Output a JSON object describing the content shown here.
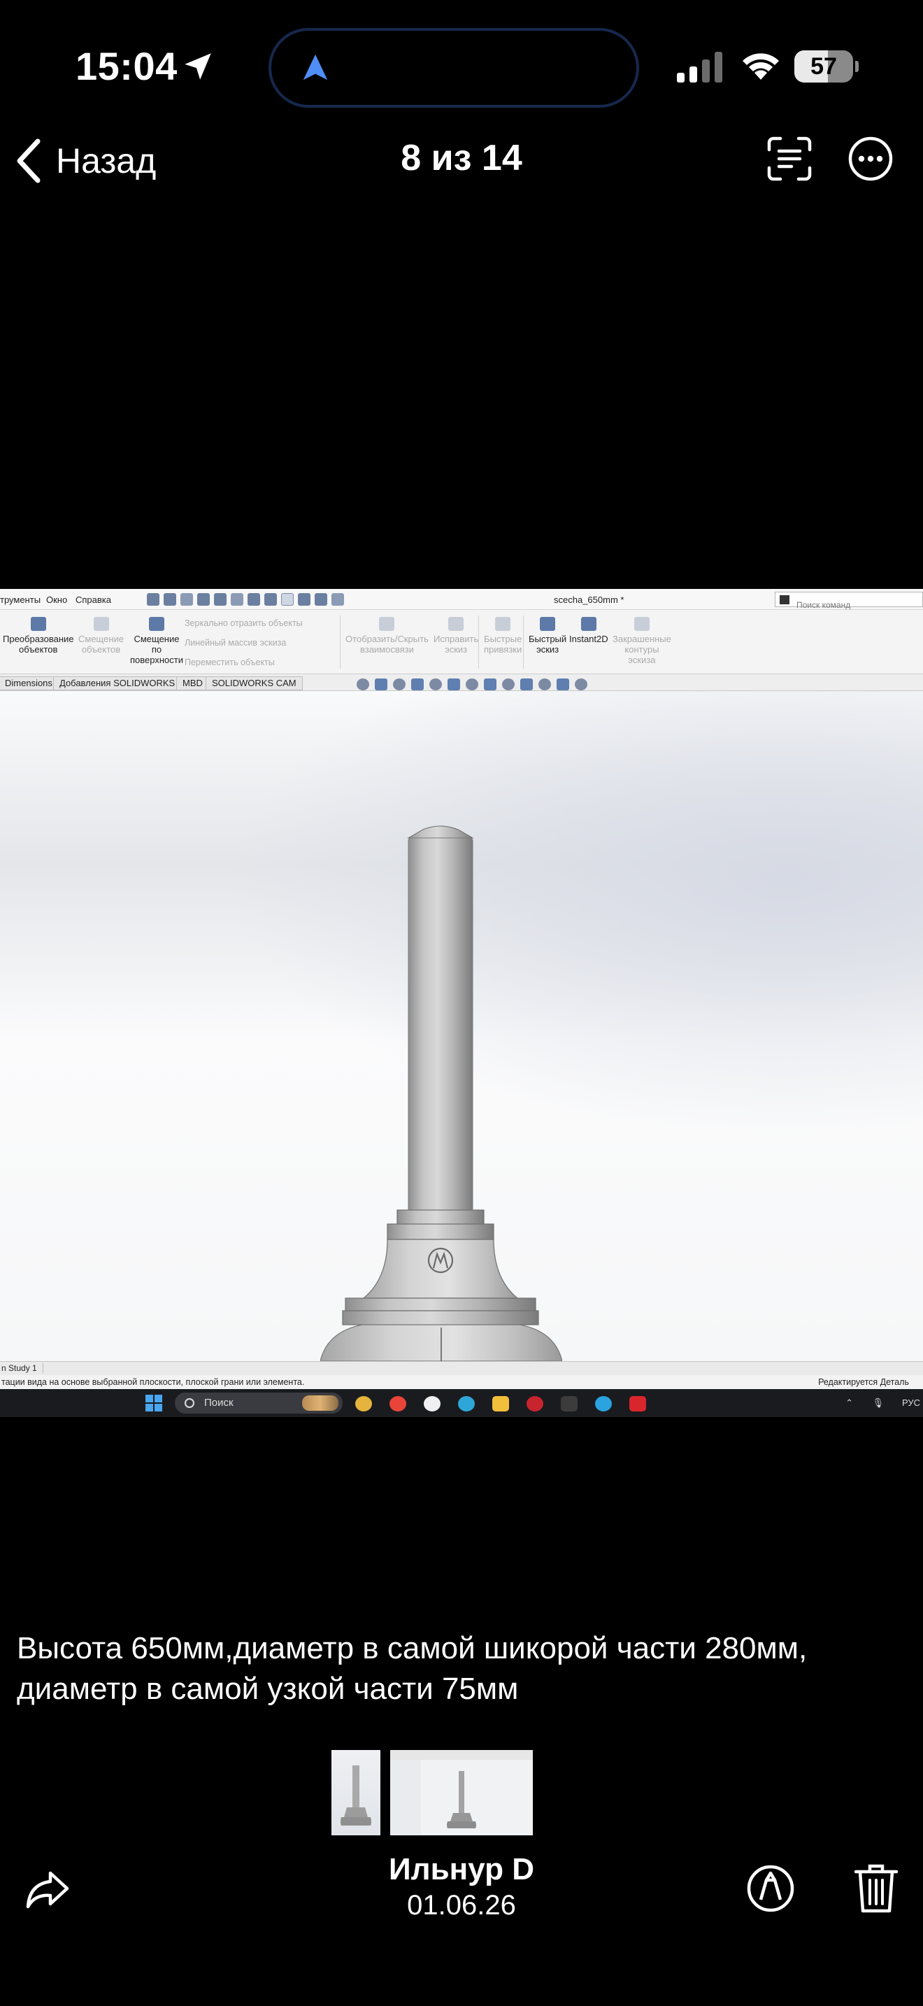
{
  "status_bar": {
    "time": "15:04",
    "battery_percent": 57,
    "battery_label": "57",
    "location_icon": "location-arrow-icon",
    "nav_icon": "navigation-arrow-icon"
  },
  "nav": {
    "back_label": "Назад",
    "counter": "8 из 14",
    "scan_icon": "text-scan-icon",
    "more_icon": "ellipsis-circle-icon"
  },
  "photo": {
    "sw_menu": [
      "трументы",
      "Окно",
      "Справка"
    ],
    "sw_window_title": "scecha_650mm *",
    "sw_search_placeholder": "Поиск команд",
    "ribbon": {
      "transform_objects": [
        "Преобразование",
        "объектов"
      ],
      "offset_objects": [
        "Смещение",
        "объектов"
      ],
      "offset_surface": [
        "Смещение",
        "по",
        "поверхности"
      ],
      "mirror": "Зеркально отразить объекты",
      "linear_pattern": "Линейный массив эскиза",
      "move_objects": "Переместить объекты",
      "show_hide": [
        "Отобразить/Скрыть",
        "взаимосвязи"
      ],
      "repair_sketch": [
        "Исправить",
        "эскиз"
      ],
      "quick_snaps": [
        "Быстрые",
        "привязки"
      ],
      "rapid_sketch": [
        "Быстрый",
        "эскиз"
      ],
      "instant2d": "Instant2D",
      "shaded_contours": [
        "Закрашенные",
        "контуры",
        "эскиза"
      ]
    },
    "tabs": [
      "Dimensions",
      "Добавления SOLIDWORKS",
      "MBD",
      "SOLIDWORKS CAM"
    ],
    "study_tab": "n Study 1",
    "status_left": "тации вида на основе выбранной плоскости, плоской грани или элемента.",
    "status_right": "Редактируется Деталь",
    "taskbar_search": "Поиск",
    "tray_lang": "РУС"
  },
  "caption": "Высота 650мм,диаметр в самой шикорой части 280мм, диаметр в самой узкой части 75мм",
  "footer": {
    "author": "Ильнур D",
    "date": "01.06.26",
    "share_icon": "share-arrow-icon",
    "markup_icon": "markup-pen-icon",
    "trash_icon": "trash-icon"
  },
  "colors": {
    "background": "#000000",
    "island_border": "#16284d",
    "nav_arrow": "#4f8ef7"
  }
}
